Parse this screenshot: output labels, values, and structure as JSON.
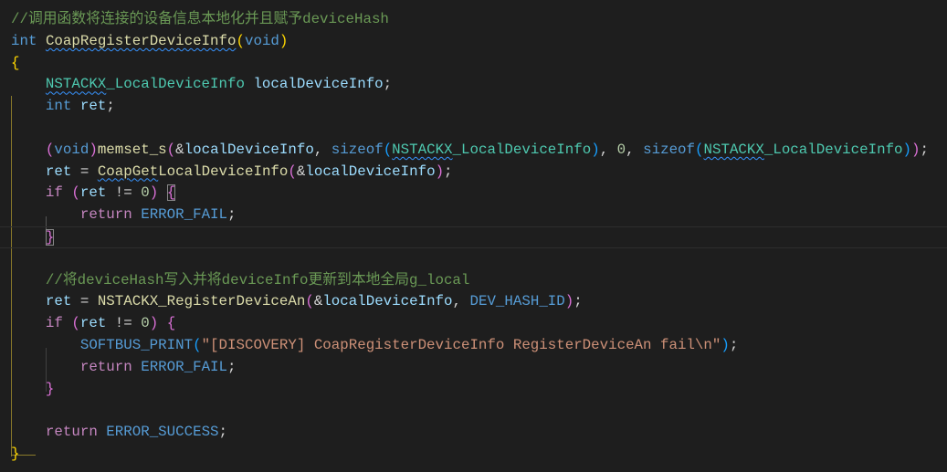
{
  "editor": {
    "theme_colors": {
      "background": "#1e1e1e",
      "comment": "#6a9955",
      "keyword": "#569cd6",
      "function": "#dcdcaa",
      "type": "#4ec9b0",
      "variable": "#9cdcfe",
      "number": "#b5cea8",
      "string": "#ce9178",
      "control": "#c586c0"
    },
    "current_line": 11,
    "lines": [
      [
        [
          "//调用函数将连接的设备信息本地化并且赋予deviceHash",
          "cm"
        ]
      ],
      [
        [
          "int",
          "kw"
        ],
        [
          " ",
          "op"
        ],
        [
          "CoapRegisterDeviceInfo",
          "fn sq"
        ],
        [
          "(",
          "b1"
        ],
        [
          "void",
          "kw"
        ],
        [
          ")",
          "b1"
        ]
      ],
      [
        [
          "{",
          "b1"
        ]
      ],
      [
        [
          "    ",
          "op"
        ],
        [
          "NSTACKX",
          "ty sq"
        ],
        [
          "_LocalDeviceInfo",
          "ty"
        ],
        [
          " ",
          "op"
        ],
        [
          "localDeviceInfo",
          "va"
        ],
        [
          ";",
          "op"
        ]
      ],
      [
        [
          "    ",
          "op"
        ],
        [
          "int",
          "kw"
        ],
        [
          " ",
          "op"
        ],
        [
          "ret",
          "va"
        ],
        [
          ";",
          "op"
        ]
      ],
      [],
      [
        [
          "    ",
          "op"
        ],
        [
          "(",
          "b2"
        ],
        [
          "void",
          "kw"
        ],
        [
          ")",
          "b2"
        ],
        [
          "memset_s",
          "fn"
        ],
        [
          "(",
          "b2"
        ],
        [
          "&",
          "op"
        ],
        [
          "localDeviceInfo",
          "va"
        ],
        [
          ", ",
          "op"
        ],
        [
          "sizeof",
          "kw"
        ],
        [
          "(",
          "b3"
        ],
        [
          "NSTACKX",
          "ty sq"
        ],
        [
          "_LocalDeviceInfo",
          "ty"
        ],
        [
          ")",
          "b3"
        ],
        [
          ", ",
          "op"
        ],
        [
          "0",
          "nu"
        ],
        [
          ", ",
          "op"
        ],
        [
          "sizeof",
          "kw"
        ],
        [
          "(",
          "b3"
        ],
        [
          "NSTACKX",
          "ty sq"
        ],
        [
          "_LocalDeviceInfo",
          "ty"
        ],
        [
          ")",
          "b3"
        ],
        [
          ")",
          "b2"
        ],
        [
          ";",
          "op"
        ]
      ],
      [
        [
          "    ",
          "op"
        ],
        [
          "ret",
          "va"
        ],
        [
          " = ",
          "op"
        ],
        [
          "CoapGet",
          "fn sq"
        ],
        [
          "LocalDeviceInfo",
          "fn"
        ],
        [
          "(",
          "b2"
        ],
        [
          "&",
          "op"
        ],
        [
          "localDeviceInfo",
          "va"
        ],
        [
          ")",
          "b2"
        ],
        [
          ";",
          "op"
        ]
      ],
      [
        [
          "    ",
          "op"
        ],
        [
          "if",
          "ct"
        ],
        [
          " ",
          "op"
        ],
        [
          "(",
          "b2"
        ],
        [
          "ret",
          "va"
        ],
        [
          " != ",
          "op"
        ],
        [
          "0",
          "nu"
        ],
        [
          ")",
          "b2"
        ],
        [
          " ",
          "op"
        ],
        [
          "{",
          "b2 bm"
        ]
      ],
      [
        [
          "        ",
          "op"
        ],
        [
          "return",
          "ct"
        ],
        [
          " ",
          "op"
        ],
        [
          "ERROR_FAIL",
          "ma"
        ],
        [
          ";",
          "op"
        ]
      ],
      [
        [
          "    ",
          "op"
        ],
        [
          "}",
          "b2 bm"
        ]
      ],
      [],
      [
        [
          "    ",
          "op"
        ],
        [
          "//将deviceHash写入并将deviceInfo更新到本地全局g_local",
          "cm"
        ]
      ],
      [
        [
          "    ",
          "op"
        ],
        [
          "ret",
          "va"
        ],
        [
          " = ",
          "op"
        ],
        [
          "NSTACKX_RegisterDeviceAn",
          "fn"
        ],
        [
          "(",
          "b2"
        ],
        [
          "&",
          "op"
        ],
        [
          "localDeviceInfo",
          "va"
        ],
        [
          ", ",
          "op"
        ],
        [
          "DEV_HASH_ID",
          "ma"
        ],
        [
          ")",
          "b2"
        ],
        [
          ";",
          "op"
        ]
      ],
      [
        [
          "    ",
          "op"
        ],
        [
          "if",
          "ct"
        ],
        [
          " ",
          "op"
        ],
        [
          "(",
          "b2"
        ],
        [
          "ret",
          "va"
        ],
        [
          " != ",
          "op"
        ],
        [
          "0",
          "nu"
        ],
        [
          ")",
          "b2"
        ],
        [
          " ",
          "op"
        ],
        [
          "{",
          "b2"
        ]
      ],
      [
        [
          "        ",
          "op"
        ],
        [
          "SOFTBUS_PRINT",
          "ma"
        ],
        [
          "(",
          "b3"
        ],
        [
          "\"[DISCOVERY] CoapRegisterDeviceInfo RegisterDeviceAn fail\\n\"",
          "st"
        ],
        [
          ")",
          "b3"
        ],
        [
          ";",
          "op"
        ]
      ],
      [
        [
          "        ",
          "op"
        ],
        [
          "return",
          "ct"
        ],
        [
          " ",
          "op"
        ],
        [
          "ERROR_FAIL",
          "ma"
        ],
        [
          ";",
          "op"
        ]
      ],
      [
        [
          "    ",
          "op"
        ],
        [
          "}",
          "b2"
        ]
      ],
      [],
      [
        [
          "    ",
          "op"
        ],
        [
          "return",
          "ct"
        ],
        [
          " ",
          "op"
        ],
        [
          "ERROR_SUCCESS",
          "ma"
        ],
        [
          ";",
          "op"
        ]
      ],
      [
        [
          "}",
          "b1"
        ]
      ]
    ]
  }
}
